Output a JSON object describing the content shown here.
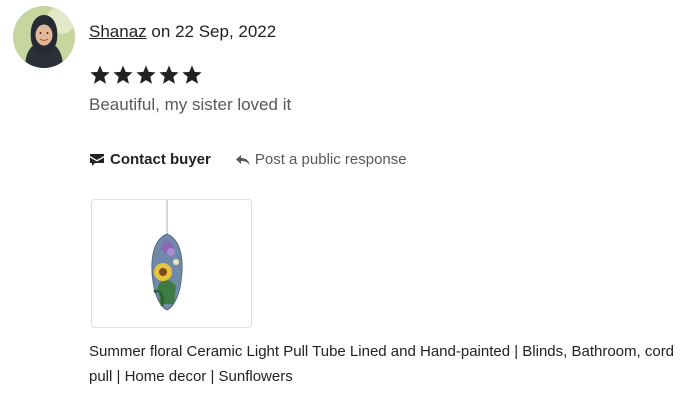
{
  "review": {
    "reviewer_name": "Shanaz",
    "date_prefix": "on",
    "date": "22 Sep, 2022",
    "rating": 5,
    "rating_max": 5,
    "text": "Beautiful, my sister loved it"
  },
  "actions": {
    "contact_label": "Contact buyer",
    "contact_icon": "envelope-flag-icon",
    "reply_label": "Post a public response",
    "reply_icon": "reply-arrow-icon"
  },
  "product": {
    "title": "Summer floral Ceramic Light Pull Tube Lined and Hand-painted | Blinds, Bathroom, cord pull | Home decor | Sunflowers"
  },
  "colors": {
    "text_primary": "#222222",
    "text_secondary": "#595959",
    "card_border": "#dddddd"
  }
}
